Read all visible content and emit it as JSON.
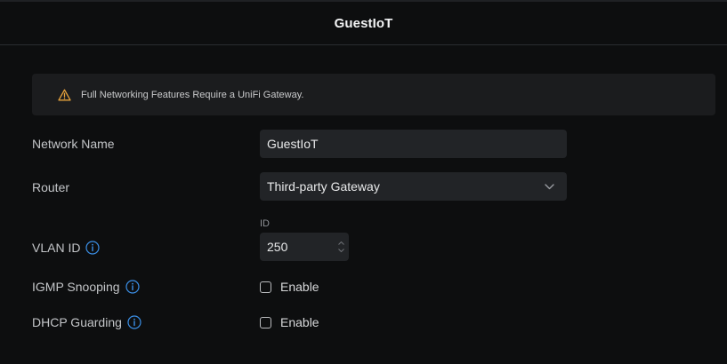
{
  "header": {
    "title": "GuestIoT"
  },
  "notice": {
    "icon": "warning-triangle-icon",
    "text": "Full Networking Features Require a UniFi Gateway.",
    "icon_color": "#e6a23c"
  },
  "form": {
    "network_name": {
      "label": "Network Name",
      "value": "GuestIoT"
    },
    "router": {
      "label": "Router",
      "value": "Third-party Gateway",
      "icon": "chevron-down-icon"
    },
    "vlan_id": {
      "label": "VLAN ID",
      "caption": "ID",
      "value": "250",
      "info_icon": "info-icon"
    },
    "igmp_snooping": {
      "label": "IGMP Snooping",
      "checkbox_label": "Enable",
      "checked": false,
      "info_icon": "info-icon"
    },
    "dhcp_guarding": {
      "label": "DHCP Guarding",
      "checkbox_label": "Enable",
      "checked": false,
      "info_icon": "info-icon"
    }
  },
  "colors": {
    "background": "#0d0e0f",
    "field": "#222427",
    "info_blue": "#3b8fe6"
  }
}
